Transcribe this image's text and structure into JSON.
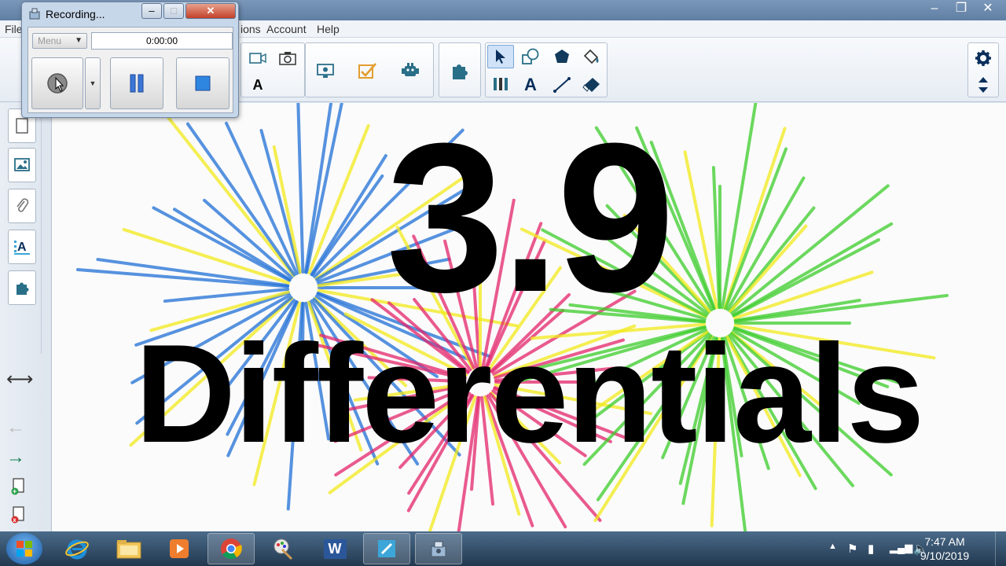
{
  "window": {
    "controls": [
      "–",
      "❐",
      "✕"
    ]
  },
  "menubar": {
    "items": [
      "File",
      "ions",
      "Account",
      "Help"
    ]
  },
  "toolbar": {
    "pen_label": "A",
    "text_tool_label": "A"
  },
  "canvas": {
    "title_line1": "3.9",
    "title_line2": "Differentials",
    "firework_colors": [
      "#1f6fd6",
      "#f2ea1a",
      "#e4256a",
      "#3ccd2a"
    ]
  },
  "recording_dialog": {
    "title": "Recording...",
    "menu_label": "Menu",
    "time": "0:00:00",
    "controls": [
      "–",
      "□",
      "✕"
    ]
  },
  "taskbar": {
    "apps": [
      "internet-explorer",
      "file-explorer",
      "media-player",
      "chrome",
      "paint",
      "word",
      "notebook",
      "recorder"
    ],
    "word_label": "W",
    "clock_time": "7:47 AM",
    "clock_date": "9/10/2019"
  },
  "colors": {
    "accent": "#2a6f88",
    "taskbar": "#22384f",
    "selected": "#cfe2f7"
  }
}
